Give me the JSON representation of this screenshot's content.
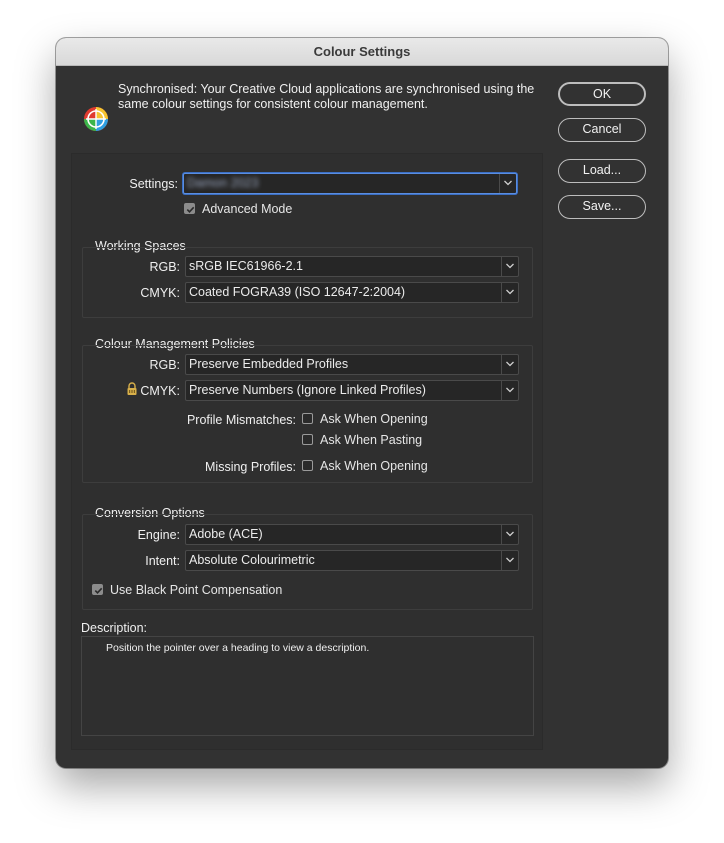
{
  "window": {
    "title": "Colour Settings"
  },
  "sync": {
    "icon": "colour-wheel-icon",
    "message": "Synchronised: Your Creative Cloud applications are synchronised using the same colour settings for consistent colour management."
  },
  "buttons": {
    "ok": "OK",
    "cancel": "Cancel",
    "load": "Load...",
    "save": "Save..."
  },
  "settings": {
    "label": "Settings:",
    "value": "Damon 2023",
    "advanced_mode": {
      "label": "Advanced Mode",
      "checked": true
    }
  },
  "working_spaces": {
    "title": "Working Spaces",
    "rgb": {
      "label": "RGB:",
      "value": "sRGB IEC61966-2.1"
    },
    "cmyk": {
      "label": "CMYK:",
      "value": "Coated FOGRA39 (ISO 12647-2:2004)"
    }
  },
  "policies": {
    "title": "Colour Management Policies",
    "rgb": {
      "label": "RGB:",
      "value": "Preserve Embedded Profiles"
    },
    "cmyk": {
      "label": "CMYK:",
      "value": "Preserve Numbers (Ignore Linked Profiles)",
      "lock_icon": "lock-icon"
    },
    "profile_mismatches": {
      "label": "Profile Mismatches:",
      "ask_opening": {
        "label": "Ask When Opening",
        "checked": false
      },
      "ask_pasting": {
        "label": "Ask When Pasting",
        "checked": false
      }
    },
    "missing_profiles": {
      "label": "Missing Profiles:",
      "ask_opening": {
        "label": "Ask When Opening",
        "checked": false
      }
    }
  },
  "conversion": {
    "title": "Conversion Options",
    "engine": {
      "label": "Engine:",
      "value": "Adobe (ACE)"
    },
    "intent": {
      "label": "Intent:",
      "value": "Absolute Colourimetric"
    },
    "black_point": {
      "label": "Use Black Point Compensation",
      "checked": true
    }
  },
  "description": {
    "label": "Description:",
    "text": "Position the pointer over a heading to view a description."
  }
}
